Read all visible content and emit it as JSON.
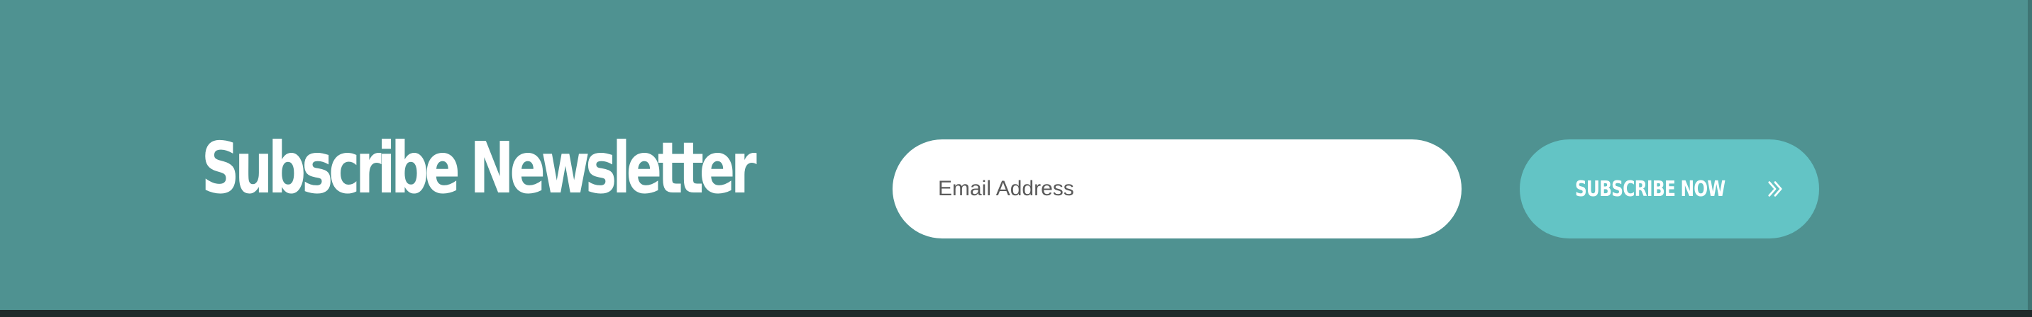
{
  "newsletter": {
    "title": "Subscribe Newsletter",
    "email_placeholder": "Email Address",
    "button_label": "SUBSCRIBE NOW",
    "button_icon": "double-chevron-right-icon"
  },
  "colors": {
    "background": "#4f9291",
    "button": "#63c4c5",
    "input": "#ffffff",
    "text": "#ffffff"
  }
}
